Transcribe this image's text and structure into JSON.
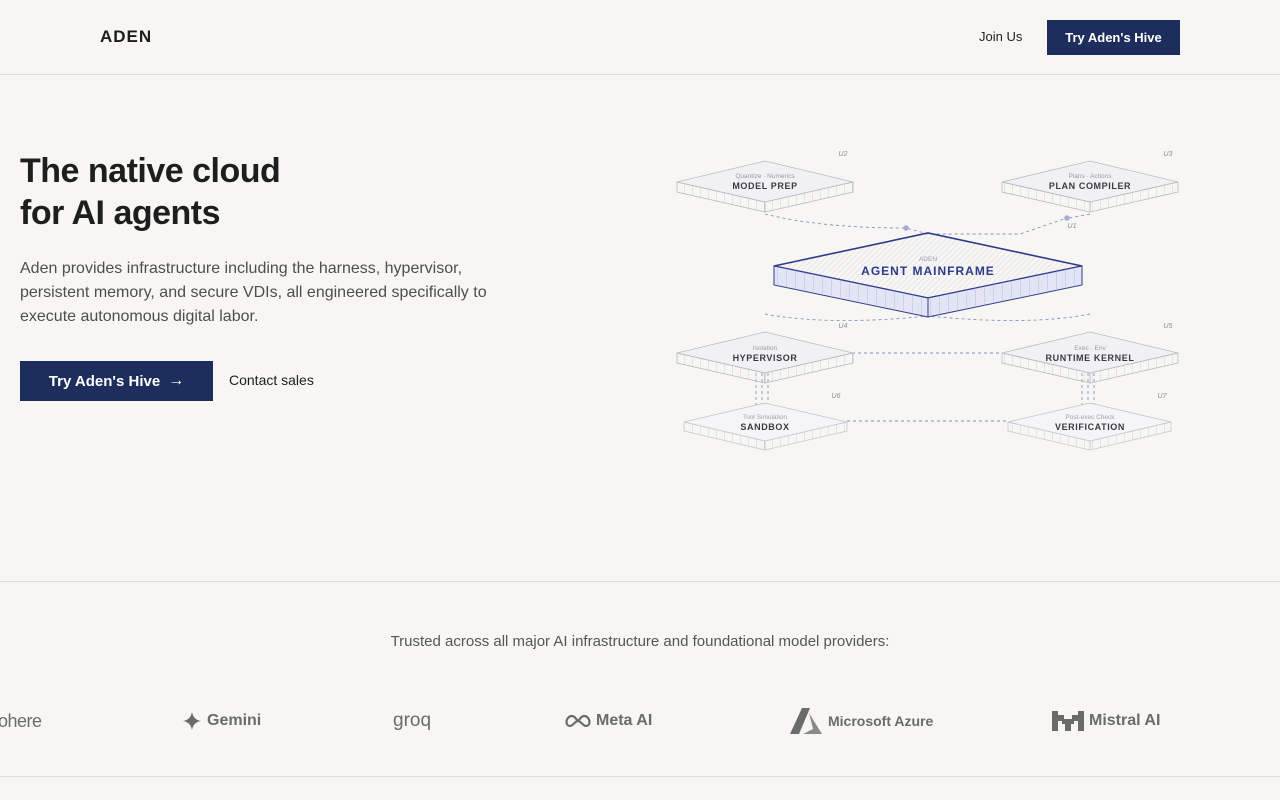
{
  "nav": {
    "brand": "ADEN",
    "join": "Join Us",
    "cta": "Try Aden's Hive"
  },
  "hero": {
    "title_line1": "The native cloud",
    "title_line2": "for AI agents",
    "subtitle": "Aden provides infrastructure including the harness, hypervisor, persistent memory, and secure VDIs, all engineered specifically to execute autonomous digital labor.",
    "cta": "Try Aden's Hive",
    "cta_icon": "arrow-right-icon",
    "secondary": "Contact sales"
  },
  "diagram": {
    "mainframe": {
      "id": "ADEN",
      "label": "AGENT MAINFRAME"
    },
    "nodes": [
      {
        "key": "model_prep",
        "id": "U2",
        "sub": "Quantize · Numerics",
        "label": "MODEL PREP"
      },
      {
        "key": "plan_compiler",
        "id": "U3",
        "sub": "Plans · Actions",
        "label": "PLAN COMPILER"
      },
      {
        "key": "hypervisor",
        "id": "U4",
        "sub": "Isolation",
        "label": "HYPERVISOR"
      },
      {
        "key": "runtime_kernel",
        "id": "U5",
        "sub": "Exec · Env",
        "label": "RUNTIME KERNEL"
      },
      {
        "key": "sandbox",
        "id": "U6",
        "sub": "Tool Simulation",
        "label": "SANDBOX"
      },
      {
        "key": "verification",
        "id": "U7",
        "sub": "Post-exec Check",
        "label": "VERIFICATION"
      }
    ],
    "u1": "U1",
    "colors": {
      "accent": "#2e3a8c",
      "line": "#6a6fb0",
      "node": "#c8c8cc"
    }
  },
  "trusted": "Trusted across all major AI infrastructure and foundational model providers:",
  "logos": [
    {
      "name": "cohere",
      "text": "ohere"
    },
    {
      "name": "gemini",
      "text": "Gemini"
    },
    {
      "name": "groq",
      "text": "groq"
    },
    {
      "name": "meta-ai",
      "text": "Meta AI"
    },
    {
      "name": "microsoft-azure",
      "text": "Microsoft Azure"
    },
    {
      "name": "mistral-ai",
      "text": "Mistral AI"
    }
  ],
  "colors": {
    "primary": "#1e2e5c",
    "background": "#f7f6f3"
  }
}
